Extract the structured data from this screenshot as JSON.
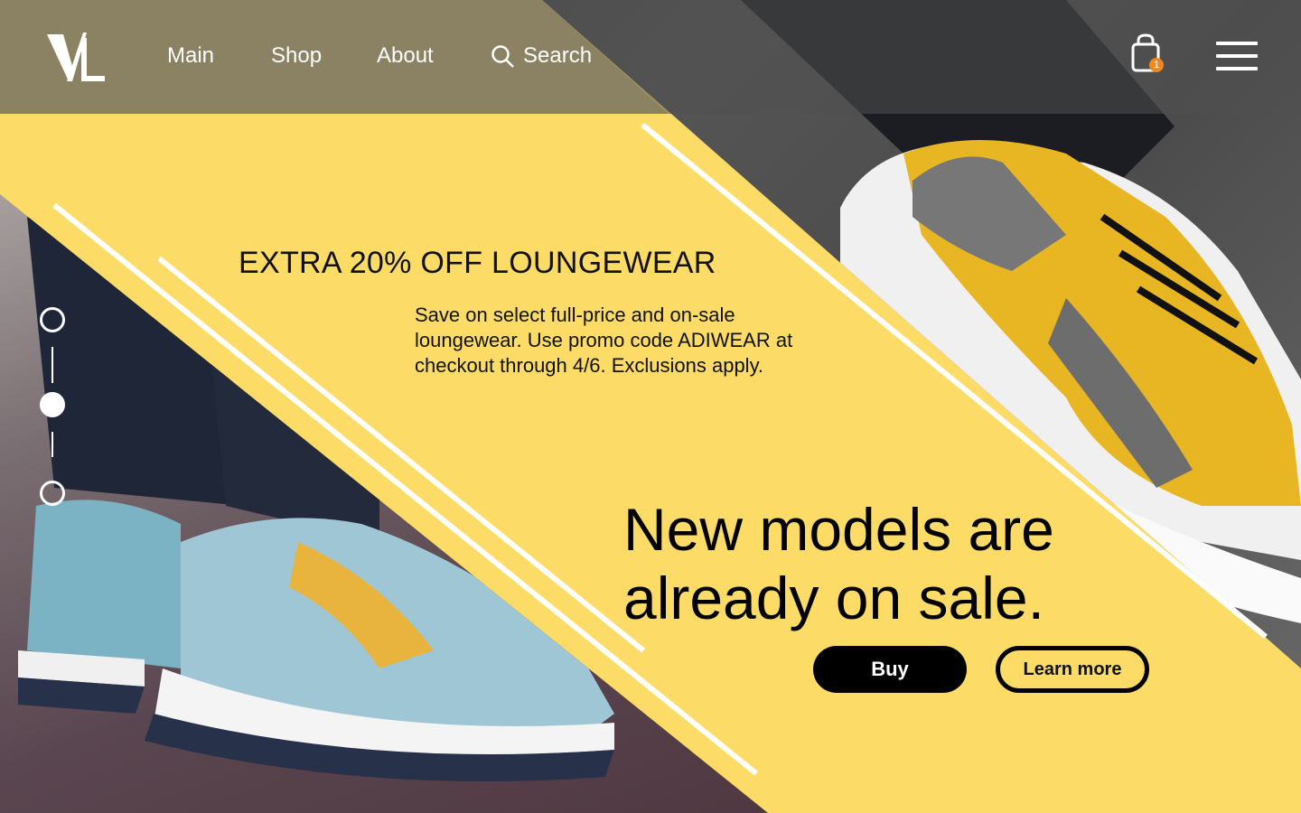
{
  "brand": {
    "logo_text": "VL"
  },
  "nav": {
    "main": "Main",
    "shop": "Shop",
    "about": "About",
    "search": "Search"
  },
  "cart": {
    "count": "1",
    "icon": "shopping-bag-icon"
  },
  "menu": {
    "icon": "hamburger-menu-icon"
  },
  "promo": {
    "title": "EXTRA 20% OFF LOUNGEWEAR",
    "body": "Save on select full-price and on-sale loungewear. Use promo code ADIWEAR at checkout through 4/6. Exclusions apply."
  },
  "hero": {
    "headline": "New models are already on sale.",
    "buy": "Buy",
    "learn_more": "Learn more"
  },
  "slider": {
    "count": 3,
    "active_index": 1
  },
  "colors": {
    "accent": "#fcdb66",
    "badge": "#f08a1c",
    "topbar_tint": "#8a8262"
  }
}
